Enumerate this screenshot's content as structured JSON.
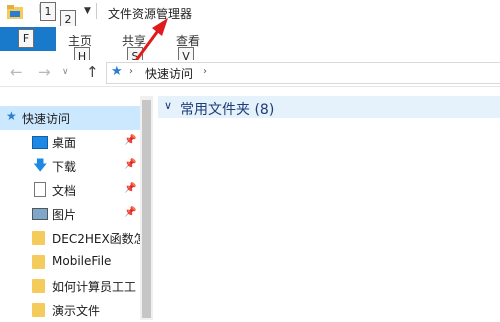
{
  "window": {
    "title": "文件资源管理器"
  },
  "keytips": {
    "qat1": "1",
    "qat2": "2",
    "file": "F",
    "home": "H",
    "share": "S",
    "view": "V"
  },
  "ribbon": {
    "tabs": [
      {
        "label": "主页"
      },
      {
        "label": "共享"
      },
      {
        "label": "查看"
      }
    ]
  },
  "address": {
    "segments": [
      "快速访问"
    ]
  },
  "nav": {
    "quick_access": "快速访问",
    "items": [
      {
        "label": "桌面",
        "icon": "desktop-icon",
        "pinned": true
      },
      {
        "label": "下载",
        "icon": "download-icon",
        "pinned": true
      },
      {
        "label": "文档",
        "icon": "document-icon",
        "pinned": true
      },
      {
        "label": "图片",
        "icon": "picture-icon",
        "pinned": true
      },
      {
        "label": "DEC2HEX函数怎",
        "icon": "folder-icon",
        "pinned": false
      },
      {
        "label": "MobileFile",
        "icon": "folder-icon",
        "pinned": false
      },
      {
        "label": "如何计算员工工",
        "icon": "folder-icon",
        "pinned": false
      },
      {
        "label": "演示文件",
        "icon": "folder-icon",
        "pinned": false
      }
    ]
  },
  "content": {
    "group_title": "常用文件夹 (8)"
  },
  "colors": {
    "accent": "#1979ca",
    "selection": "#cce8ff",
    "header_bg": "#e5f1fb",
    "arrow": "#e01b1b"
  }
}
